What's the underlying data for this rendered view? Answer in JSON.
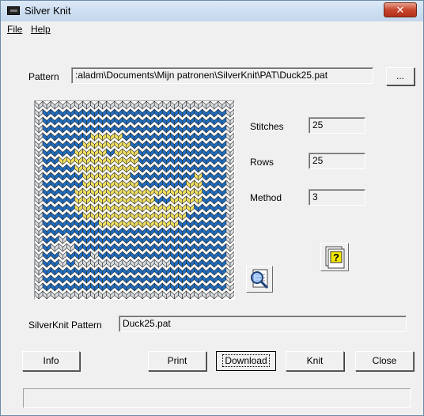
{
  "window": {
    "title": "Silver Knit"
  },
  "menu": {
    "file": "File",
    "help": "Help"
  },
  "pattern": {
    "label": "Pattern",
    "path": ":aladm\\Documents\\Mijn patronen\\SilverKnit\\PAT\\Duck25.pat",
    "browse_label": "..."
  },
  "stats": {
    "stitches_label": "Stitches",
    "stitches": "25",
    "rows_label": "Rows",
    "rows": "25",
    "method_label": "Method",
    "method": "3"
  },
  "silverknit": {
    "label": "SilverKnit Pattern",
    "value": "Duck25.pat"
  },
  "buttons": {
    "info": "Info",
    "print": "Print",
    "download": "Download",
    "knit": "Knit",
    "close": "Close"
  },
  "colors": {
    "background_yarn": "#1f6fc4",
    "duck_yarn": "#f0e060",
    "edge_yarn": "#d8dce0"
  },
  "icons": {
    "close": "close-icon",
    "zoom": "magnifier-document-icon",
    "help": "help-document-icon"
  }
}
